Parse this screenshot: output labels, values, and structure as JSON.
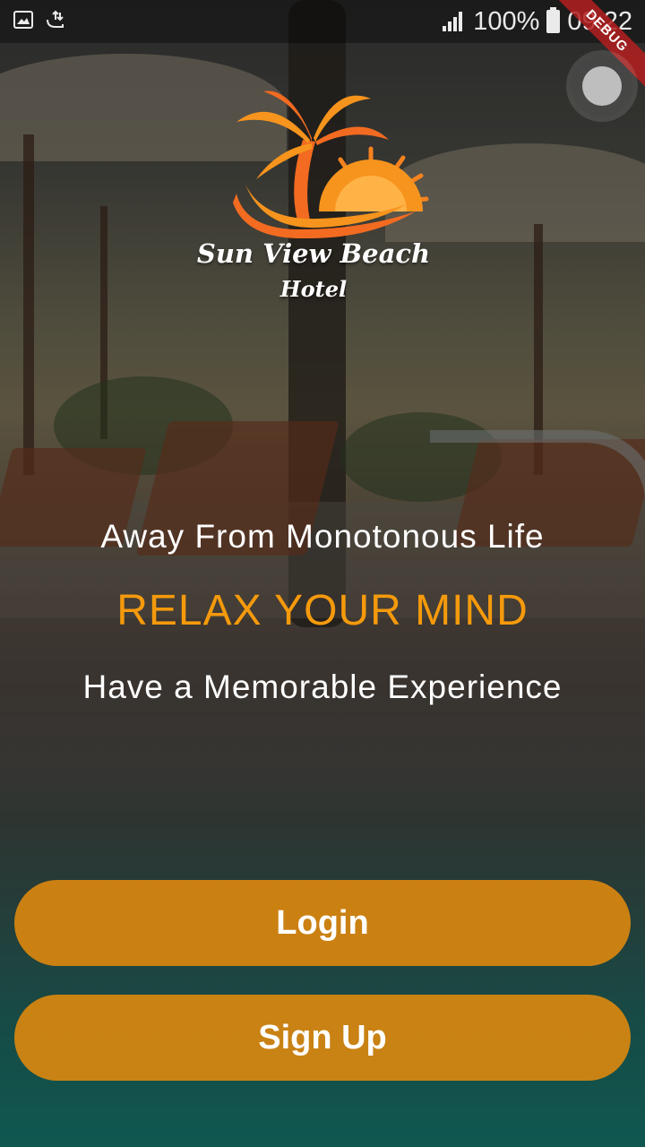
{
  "status_bar": {
    "icons": [
      "image-icon",
      "sync-icon"
    ],
    "signal_icon": "signal-icon",
    "battery": "100%",
    "battery_icon": "battery-charging-icon",
    "time": "09:22"
  },
  "debug_banner": "DEBUG",
  "logo": {
    "line1": "Sun View Beach",
    "line2": "Hotel"
  },
  "taglines": {
    "line1": "Away From Monotonous Life",
    "line2": "RELAX YOUR MIND",
    "line3": "Have a Memorable Experience"
  },
  "buttons": {
    "login": "Login",
    "signup": "Sign Up"
  },
  "colors": {
    "accent": "#f59a0c",
    "button": "#e38a0c"
  }
}
